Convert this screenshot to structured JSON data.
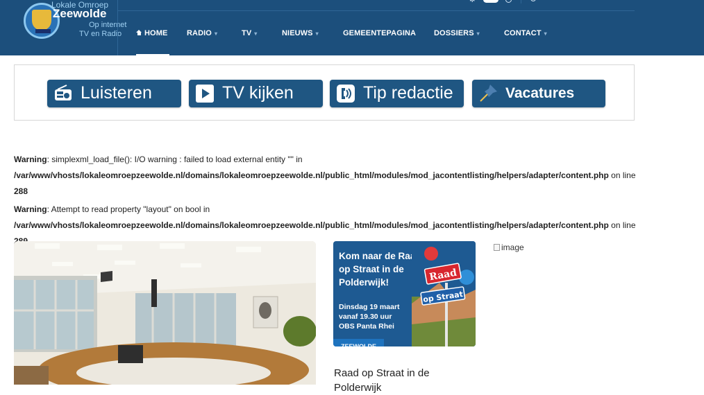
{
  "logo": {
    "line1": "Lokale Omroep",
    "line2": "Zeewolde",
    "line3": "Op internet",
    "line4": "TV en Radio"
  },
  "nav": {
    "items": [
      {
        "label": "HOME",
        "active": true,
        "icon": "home-icon",
        "dropdown": false
      },
      {
        "label": "RADIO",
        "dropdown": true
      },
      {
        "label": "TV",
        "dropdown": true
      },
      {
        "label": "NIEUWS",
        "dropdown": true
      },
      {
        "label": "GEMEENTEPAGINA",
        "dropdown": false
      },
      {
        "label": "DOSSIERS",
        "dropdown": true
      },
      {
        "label": "CONTACT",
        "dropdown": true
      }
    ]
  },
  "banners": [
    {
      "label": "Luisteren",
      "icon": "radio-icon"
    },
    {
      "label": "TV kijken",
      "icon": "play-icon"
    },
    {
      "label": "Tip redactie",
      "icon": "phone-icon"
    },
    {
      "label": "Vacatures",
      "icon": "pushpin-icon"
    }
  ],
  "warnings": [
    {
      "prefix": "Warning",
      "message": ": simplexml_load_file(): I/O warning : failed to load external entity \"\" in",
      "path": "/var/www/vhosts/lokaleomroepzeewolde.nl/domains/lokaleomroepzeewolde.nl/public_html/modules/mod_jacontentlisting/helpers/adapter/content.php",
      "on_line": " on line",
      "line": "288"
    },
    {
      "prefix": "Warning",
      "message": ": Attempt to read property \"layout\" on bool in",
      "path": "/var/www/vhosts/lokaleomroepzeewolde.nl/domains/lokaleomroepzeewolde.nl/public_html/modules/mod_jacontentlisting/helpers/adapter/content.php",
      "on_line": " on line",
      "line": "289"
    }
  ],
  "promo": {
    "headline": "Kom naar de Raad op Straat in de Polderwijk!",
    "date_line1": "Dinsdag 19 maart",
    "date_line2": "vanaf 19.30 uur",
    "date_line3": "OBS Panta Rhei",
    "sign_top": "Raad",
    "sign_bottom": "op Straat",
    "tag": "ZEEWOLDE"
  },
  "image_alt": "image",
  "article_title": "Raad op Straat in de Polderwijk"
}
